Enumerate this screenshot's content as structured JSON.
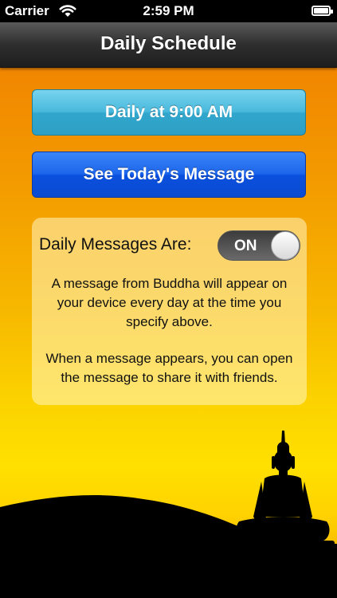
{
  "status_bar": {
    "carrier": "Carrier",
    "time": "2:59 PM"
  },
  "nav": {
    "title": "Daily Schedule"
  },
  "buttons": {
    "time_button_label": "Daily at 9:00 AM",
    "message_button_label": "See Today's Message"
  },
  "panel": {
    "label": "Daily Messages Are:",
    "toggle_value": "ON",
    "paragraph1": [
      "A message from Buddha will appear on",
      "your device every day at the time you",
      "specify above."
    ],
    "paragraph2": [
      "When a message appears, you can open",
      "the message to share it with friends."
    ]
  },
  "colors": {
    "time_button": "#49b9dc",
    "message_button": "#1d66ec",
    "background_top": "#f07a00",
    "background_mid": "#fcd400"
  },
  "icons": [
    "wifi-icon",
    "battery-icon",
    "buddha-silhouette"
  ]
}
